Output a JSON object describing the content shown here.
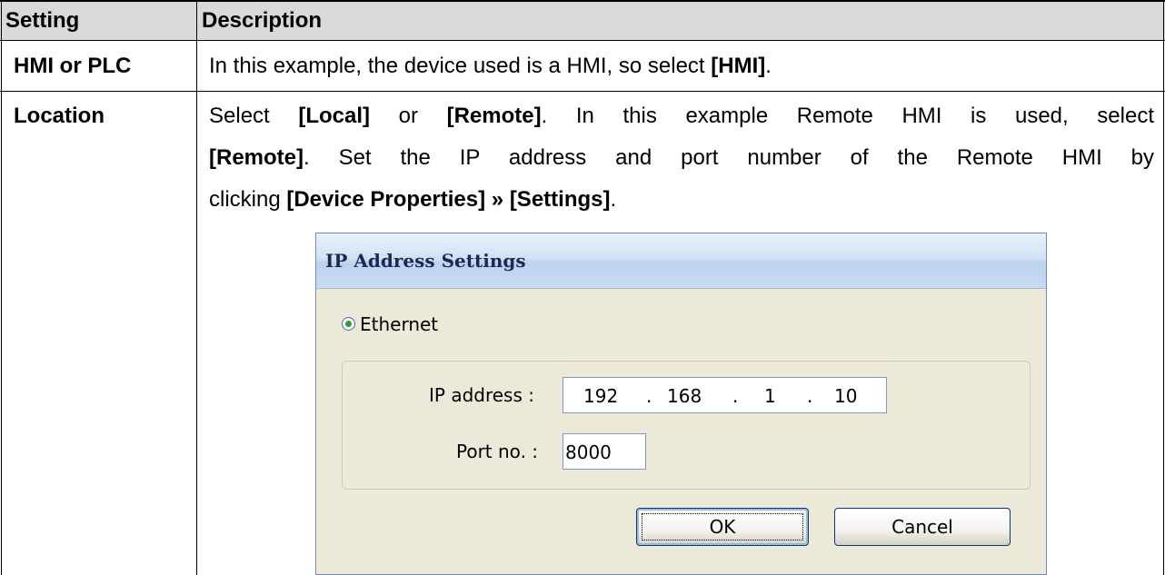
{
  "table": {
    "headers": [
      "Setting",
      "Description"
    ],
    "rows": [
      {
        "setting": "HMI or PLC",
        "desc_parts": [
          "In this example, the device used is a HMI, so select ",
          "[HMI]",
          "."
        ]
      },
      {
        "setting": "Location",
        "line1_parts": [
          "Select ",
          "[Local]",
          " or ",
          "[Remote]",
          ". In this example Remote HMI is used, select"
        ],
        "line2_parts": [
          "[Remote]",
          ". Set the IP address and port number of the Remote HMI by"
        ],
        "line3_parts": [
          "clicking ",
          "[Device Properties]",
          " » ",
          "[Settings]",
          "."
        ]
      }
    ],
    "header_bg": "#d9d9d9"
  },
  "dialog": {
    "title": "IP Address Settings",
    "radio_label": "Ethernet",
    "radio_selected": true,
    "ip_label": "IP address :",
    "ip_segments": [
      "192",
      ".",
      "168",
      ".",
      "1",
      ".",
      "10"
    ],
    "port_label": "Port no. :",
    "port_value": "8000",
    "ok_label": "OK",
    "cancel_label": "Cancel",
    "accent_color": "#2aa02a"
  }
}
